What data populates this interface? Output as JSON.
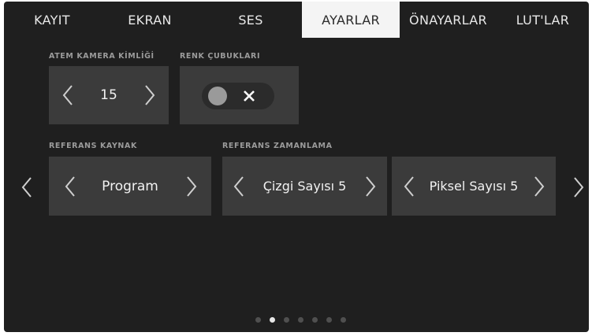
{
  "tabs": [
    {
      "label": "KAYIT",
      "active": false
    },
    {
      "label": "EKRAN",
      "active": false
    },
    {
      "label": "SES",
      "active": false
    },
    {
      "label": "AYARLAR",
      "active": true
    },
    {
      "label": "ÖNAYARLAR",
      "active": false
    },
    {
      "label": "LUT'LAR",
      "active": false
    }
  ],
  "atem_camera_id": {
    "label": "ATEM KAMERA KİMLİĞİ",
    "value": "15"
  },
  "color_bars": {
    "label": "RENK ÇUBUKLARI",
    "state": "off"
  },
  "reference_source": {
    "label": "REFERANS KAYNAK",
    "value": "Program"
  },
  "reference_timing": {
    "label": "REFERANS ZAMANLAMA",
    "lines": "Çizgi Sayısı 5",
    "pixels": "Piksel Sayısı 5"
  },
  "pagination": {
    "total_pages": 7,
    "current_page": 2
  },
  "colors": {
    "screen_bg": "#1f1f1f",
    "box_bg": "#3b3b3b",
    "active_tab_bg": "#f4f4f4",
    "label": "#9b9b9b"
  },
  "icons": [
    "chevron-left-icon",
    "chevron-right-icon",
    "x-icon"
  ]
}
